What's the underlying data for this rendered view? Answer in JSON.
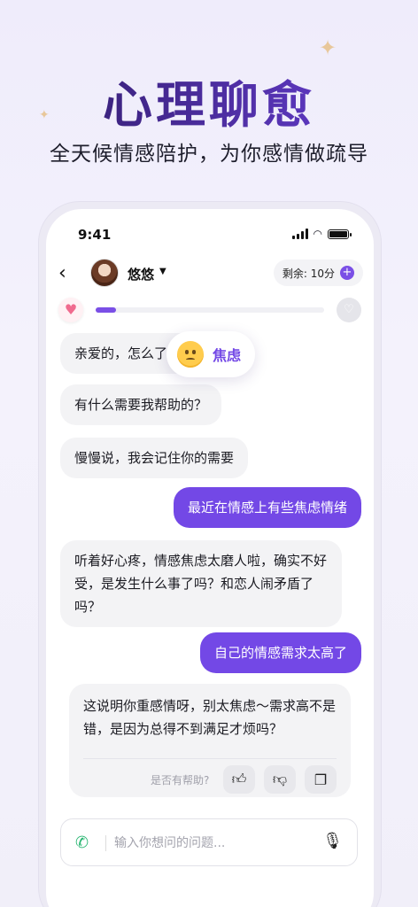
{
  "hero": {
    "title": "心理聊愈",
    "subtitle": "全天候情感陪护，为你感情做疏导"
  },
  "status_bar": {
    "time": "9:41"
  },
  "header": {
    "persona_name": "悠悠",
    "remaining": "剩余: 10分"
  },
  "mood": {
    "progress": 0.09
  },
  "emotion": {
    "label": "焦虑"
  },
  "messages": [
    {
      "role": "ai",
      "text": "亲爱的，怎么了？"
    },
    {
      "role": "ai",
      "text": "有什么需要我帮助的？"
    },
    {
      "role": "ai",
      "text": "慢慢说，我会记住你的需要"
    },
    {
      "role": "user",
      "text": "最近在情感上有些焦虑情绪"
    },
    {
      "role": "ai",
      "text": "听着好心疼，情感焦虑太磨人啦，确实不好受，是发生什么事了吗？和恋人闹矛盾了吗？"
    },
    {
      "role": "user",
      "text": "自己的情感需求太高了"
    },
    {
      "role": "ai",
      "text": "这说明你重感情呀，别太焦虑～需求高不是错，是因为总得不到满足才烦吗？"
    }
  ],
  "feedback": {
    "prompt": "是否有帮助?"
  },
  "input": {
    "placeholder": "输入你想问的问题..."
  },
  "colors": {
    "accent": "#7348e6",
    "call": "#2bb673"
  }
}
